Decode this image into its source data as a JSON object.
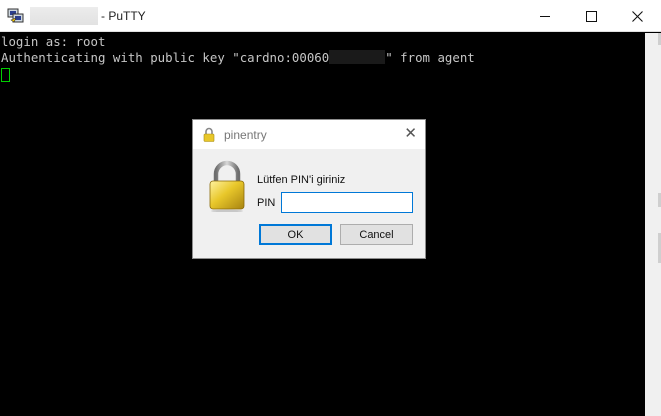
{
  "window": {
    "title_suffix": "- PuTTY",
    "controls": {
      "minimize": "—",
      "maximize": "☐",
      "close": "✕"
    }
  },
  "terminal": {
    "lines": [
      "login as: root",
      "Authenticating with public key \"cardno:00060"
    ],
    "line2_tail": "\" from agent",
    "cursor_color": "#00d000",
    "text_color": "#c6c6c6"
  },
  "dialog": {
    "title": "pinentry",
    "close": "✕",
    "prompt": "Lütfen PIN'i giriniz",
    "pin_label": "PIN",
    "pin_value": "",
    "ok_label": "OK",
    "cancel_label": "Cancel",
    "accent": "#0078d7",
    "lock_color": "#e8c72a"
  }
}
